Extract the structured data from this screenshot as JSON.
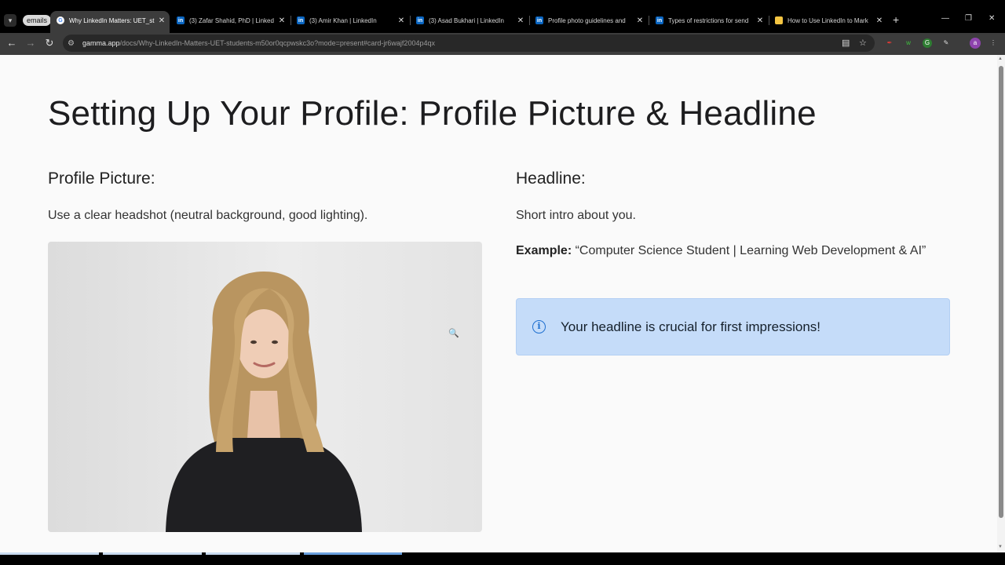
{
  "browser": {
    "tab_group_label": "emails",
    "tabs": [
      {
        "title": "Why LinkedIn Matters: UET_st",
        "favicon": "gamma-icon",
        "active": true
      },
      {
        "title": "(3) Zafar Shahid, PhD | Linked",
        "favicon": "linkedin-icon"
      },
      {
        "title": "(3) Amir Khan | LinkedIn",
        "favicon": "linkedin-icon"
      },
      {
        "title": "(3) Asad Bukhari | LinkedIn",
        "favicon": "linkedin-icon"
      },
      {
        "title": "Profile photo guidelines and",
        "favicon": "linkedin-icon"
      },
      {
        "title": "Types of restrictions for send",
        "favicon": "linkedin-icon"
      },
      {
        "title": "How to Use LinkedIn to Mark",
        "favicon": "note-icon"
      }
    ],
    "url_host": "gamma.app",
    "url_path": "/docs/Why-LinkedIn-Matters-UET-students-m50or0qcpwskc3o?mode=present#card-jr6wajf2004p4qx",
    "profile_initial": "a"
  },
  "slide": {
    "title": "Setting Up Your Profile: Profile Picture & Headline",
    "left": {
      "heading": "Profile Picture:",
      "text": "Use a clear headshot (neutral background, good lighting)."
    },
    "right": {
      "heading": "Headline:",
      "text": "Short intro about you.",
      "example_label": "Example:",
      "example_text": " “Computer Science Student | Learning Web Development & AI”",
      "callout": "Your headline is crucial for first impressions!"
    }
  },
  "colors": {
    "callout_bg": "#c5dcf9",
    "info_icon": "#1e6fd0",
    "progress_active": "#6aa0de"
  }
}
